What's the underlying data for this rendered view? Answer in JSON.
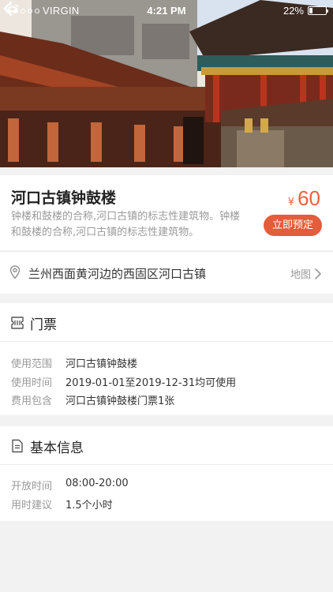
{
  "status_bar": {
    "carrier": "VIRGIN",
    "time": "4:21 PM",
    "battery_text": "22%",
    "battery_level": 0.22
  },
  "hero": {
    "back_icon": "chevron-left-icon"
  },
  "attraction": {
    "title": "河口古镇钟鼓楼",
    "description": "钟楼和鼓楼的合称,河口古镇的标志性建筑物。钟楼和鼓楼的合称,河口古镇的标志性建筑物。",
    "price_symbol": "¥",
    "price": "60",
    "book_button": "立即预定",
    "accent_color": "#e35d3a"
  },
  "address": {
    "icon": "location-pin-icon",
    "text": "兰州西面黄河边的西固区河口古镇",
    "map_label": "地图"
  },
  "ticket": {
    "icon": "ticket-icon",
    "title": "门票",
    "rows": [
      {
        "label": "使用范围",
        "value": "河口古镇钟鼓楼"
      },
      {
        "label": "使用时间",
        "value": "2019-01-01至2019-12-31均可使用"
      },
      {
        "label": "费用包含",
        "value": "河口古镇钟鼓楼门票1张"
      }
    ]
  },
  "basic_info": {
    "icon": "document-icon",
    "title": "基本信息",
    "rows": [
      {
        "label": "开放时间",
        "value": "08:00-20:00"
      },
      {
        "label": "用时建议",
        "value": "1.5个小时"
      }
    ]
  }
}
